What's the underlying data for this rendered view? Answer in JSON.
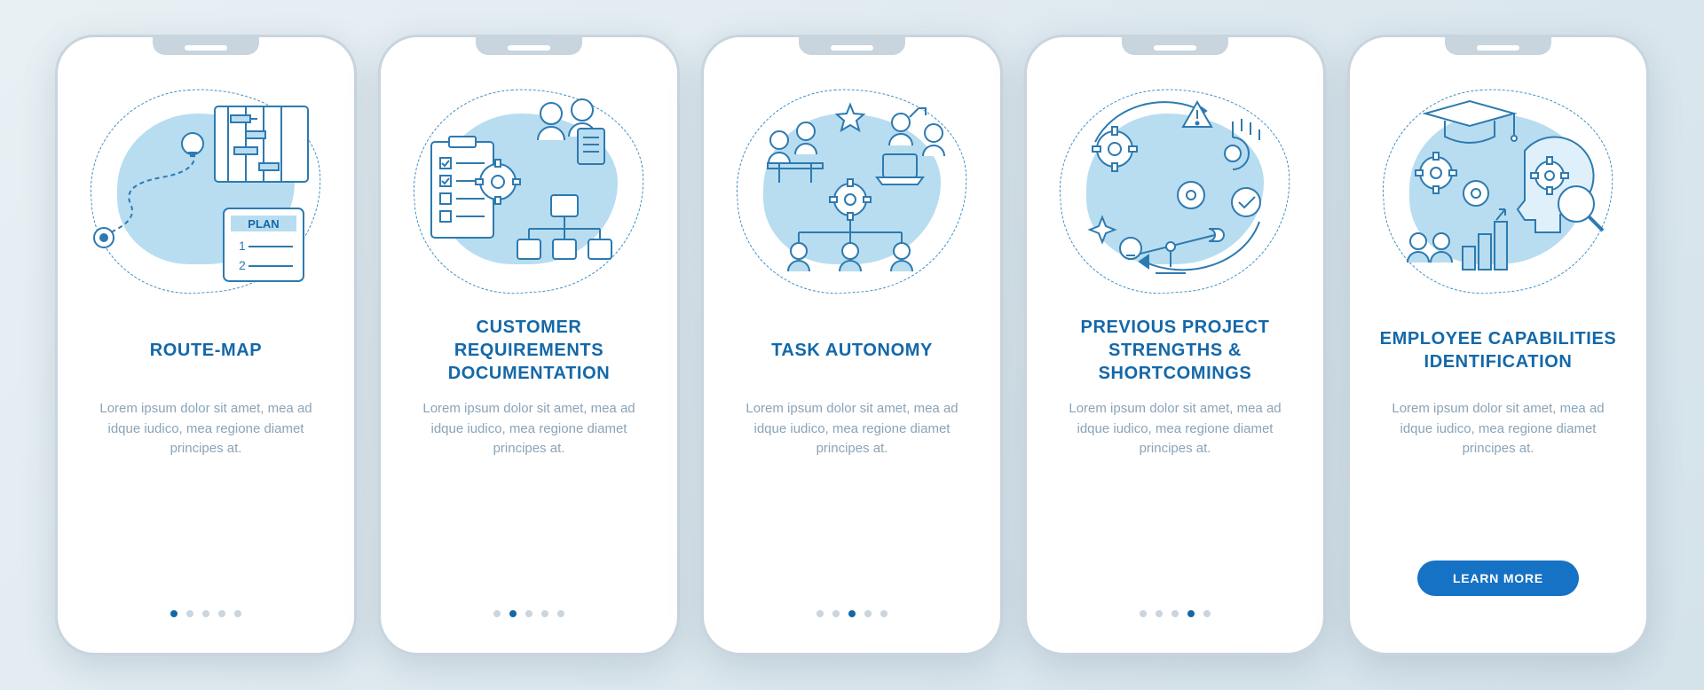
{
  "colors": {
    "primary": "#1468a8",
    "accent": "#1672c4",
    "blob": "#b8ddf0",
    "line": "#3a8cc4",
    "muted": "#8aa4b8",
    "dot_inactive": "#c9d5df",
    "background_start": "#e8f0f4",
    "background_end": "#d4e2ea"
  },
  "screens": [
    {
      "icon": "route-map",
      "title": "ROUTE-MAP",
      "description": "Lorem ipsum dolor sit amet, mea ad idque iudico, mea regione diamet principes at.",
      "active_dot": 0
    },
    {
      "icon": "customer-requirements",
      "title": "CUSTOMER REQUIREMENTS DOCUMENTATION",
      "description": "Lorem ipsum dolor sit amet, mea ad idque iudico, mea regione diamet principes at.",
      "active_dot": 1
    },
    {
      "icon": "task-autonomy",
      "title": "TASK AUTONOMY",
      "description": "Lorem ipsum dolor sit amet, mea ad idque iudico, mea regione diamet principes at.",
      "active_dot": 2
    },
    {
      "icon": "previous-project",
      "title": "PREVIOUS PROJECT STRENGTHS & SHORTCOMINGS",
      "description": "Lorem ipsum dolor sit amet, mea ad idque iudico, mea regione diamet principes at.",
      "active_dot": 3
    },
    {
      "icon": "employee-capabilities",
      "title": "EMPLOYEE CAPABILITIES IDENTIFICATION",
      "description": "Lorem ipsum dolor sit amet, mea ad idque iudico, mea regione diamet principes at.",
      "active_dot": 4,
      "cta": "LEARN MORE"
    }
  ],
  "dot_count": 5
}
